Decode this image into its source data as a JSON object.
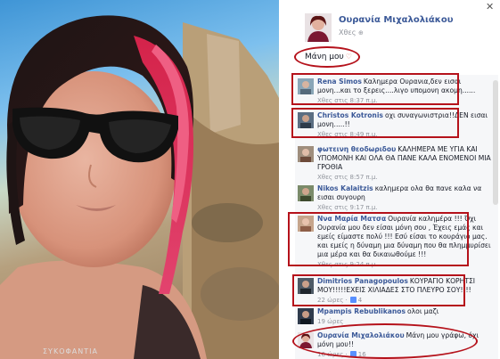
{
  "photo": {
    "bottom_text": "ΣΥΚΟΦΑΝΤΙΑ"
  },
  "post": {
    "author": "Ουρανία Μιχαλολιάκου",
    "time": "Χθες",
    "caption": "Μάνη μου"
  },
  "icons": {
    "close": "close-icon",
    "globe": "globe-icon",
    "heart": "heart-icon",
    "like": "like-icon"
  },
  "comments": [
    {
      "name": "Rena Simos",
      "text": "Καλημερα Ουρανια,δεν εισαι μονη...και το ξερεις....λιγο υπομονη ακομη......",
      "meta": "Χθες στις 8:37 π.μ.",
      "likes": ""
    },
    {
      "name": "Christos Kotronis",
      "text": "οχι συναγωνιστρια!!ΔΕΝ εισαι μονη.....!!",
      "meta": "Χθες στις 8:49 π.μ.",
      "likes": ""
    },
    {
      "name": "φωτεινη θεοδωριδου",
      "text": "ΚΑΛΗΜΕΡΑ ΜΕ ΥΓΙΑ ΚΑΙ ΥΠΟΜΟΝΗ ΚΑΙ ΟΛΑ ΘΑ ΠΑΝΕ ΚΑΛΑ ΕΝΟΜΕΝΟΙ ΜΙΑ ΓΡΟΘΙΑ",
      "meta": "Χθες στις 8:57 π.μ.",
      "likes": ""
    },
    {
      "name": "Nikos Kalaitzis",
      "text": "καλημερα ολα θα πανε καλα να εισαι συγουρη",
      "meta": "Χθες στις 9:17 π.μ.",
      "likes": ""
    },
    {
      "name": "Ννα Μαρία Ματσα",
      "text": "Ουρανία καλημέρα !!! Όχι Ουρανία μου δεν είσαι μόνη σου , Έχεις εμάς και εμείς είμαστε πολύ !!! Εσύ είσαι το κουράγιο μας. και εμείς η δύναμη μια δύναμη που θα πλημμυρίσει μια μέρα και θα δικαιωθούμε !!!",
      "meta": "Χθες στις 9:24 π.μ.",
      "likes": ""
    },
    {
      "name": "Dimitrios Panagopoulos",
      "text": "ΚΟΥΡΑΓΙΟ ΚΟΡΗΤΣΙ ΜΟΥ!!!!!ΕΧΕΙΣ ΧΙΛΙΑΔΕΣ ΣΤΟ ΠΛΕΥΡΟ ΣΟΥ!!!!",
      "meta": "22 ώρες ·",
      "likes": "4"
    },
    {
      "name": "Μpampis Rebublikanos",
      "text": "ολοι μαζι",
      "meta": "19 ώρες",
      "likes": ""
    },
    {
      "name": "Ουρανία Μιχαλολιάκου",
      "text": "Μάνη μου γράφω, όχι μόνη μου!!",
      "meta": "16 ώρες ·",
      "likes": "16"
    }
  ]
}
